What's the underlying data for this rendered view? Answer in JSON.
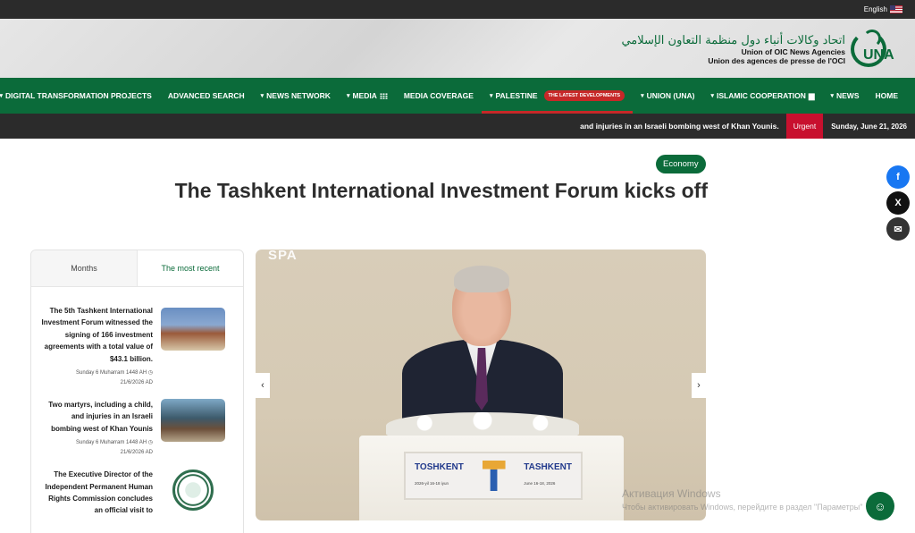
{
  "topbar": {
    "language": "English"
  },
  "logo": {
    "arabic": "اتحاد وكالات أنباء دول منظمة التعاون الإسلامي",
    "en": "Union of OIC News Agencies",
    "fr": "Union des agences de presse de l'OCI",
    "word": "UNA"
  },
  "nav": {
    "items": [
      "DIGITAL TRANSFORMATION PROJECTS",
      "ADVANCED SEARCH",
      "NEWS NETWORK",
      "MEDIA",
      "MEDIA COVERAGE",
      "PALESTINE",
      "UNION (UNA)",
      "ISLAMIC COOPERATION",
      "NEWS",
      "HOME"
    ],
    "palestine_badge": "THE LATEST DEVELOPMENTS"
  },
  "ticker": {
    "text": "and injuries in an Israeli bombing west of Khan Younis.",
    "urgent": "Urgent",
    "date": "Sunday, June 21, 2026"
  },
  "article": {
    "category": "Economy",
    "title": "The Tashkent International Investment Forum kicks off"
  },
  "side": {
    "tabs": [
      "Months",
      "The most recent"
    ],
    "news": [
      {
        "title": "The 5th Tashkent International Investment Forum witnessed the signing of 166 investment agreements with a total value of $43.1 billion.",
        "hijri": "Sunday 6 Muharram 1448 AH",
        "date": "21/6/2026 AD"
      },
      {
        "title": "Two martyrs, including a child, and injuries in an Israeli bombing west of Khan Younis",
        "hijri": "Sunday 6 Muharram 1448 AH",
        "date": "21/6/2026 AD"
      },
      {
        "title": "The Executive Director of the Independent Permanent Human Rights Commission concludes an official visit to",
        "hijri": "",
        "date": ""
      }
    ]
  },
  "hero": {
    "watermark": "SPA",
    "sign_left": "TOSHKENT",
    "sign_left_sub": "2026-yil 16-18 iyun",
    "sign_right": "TASHKENT",
    "sign_right_sub": "June 16-18, 2026"
  },
  "windows": {
    "line1": "Активация Windows",
    "line2": "Чтобы активировать Windows, перейдите в раздел \"Параметры\""
  },
  "colors": {
    "brand_green": "#0b6b3a",
    "urgent_red": "#c8102e",
    "dark_bar": "#2b2b2b"
  }
}
